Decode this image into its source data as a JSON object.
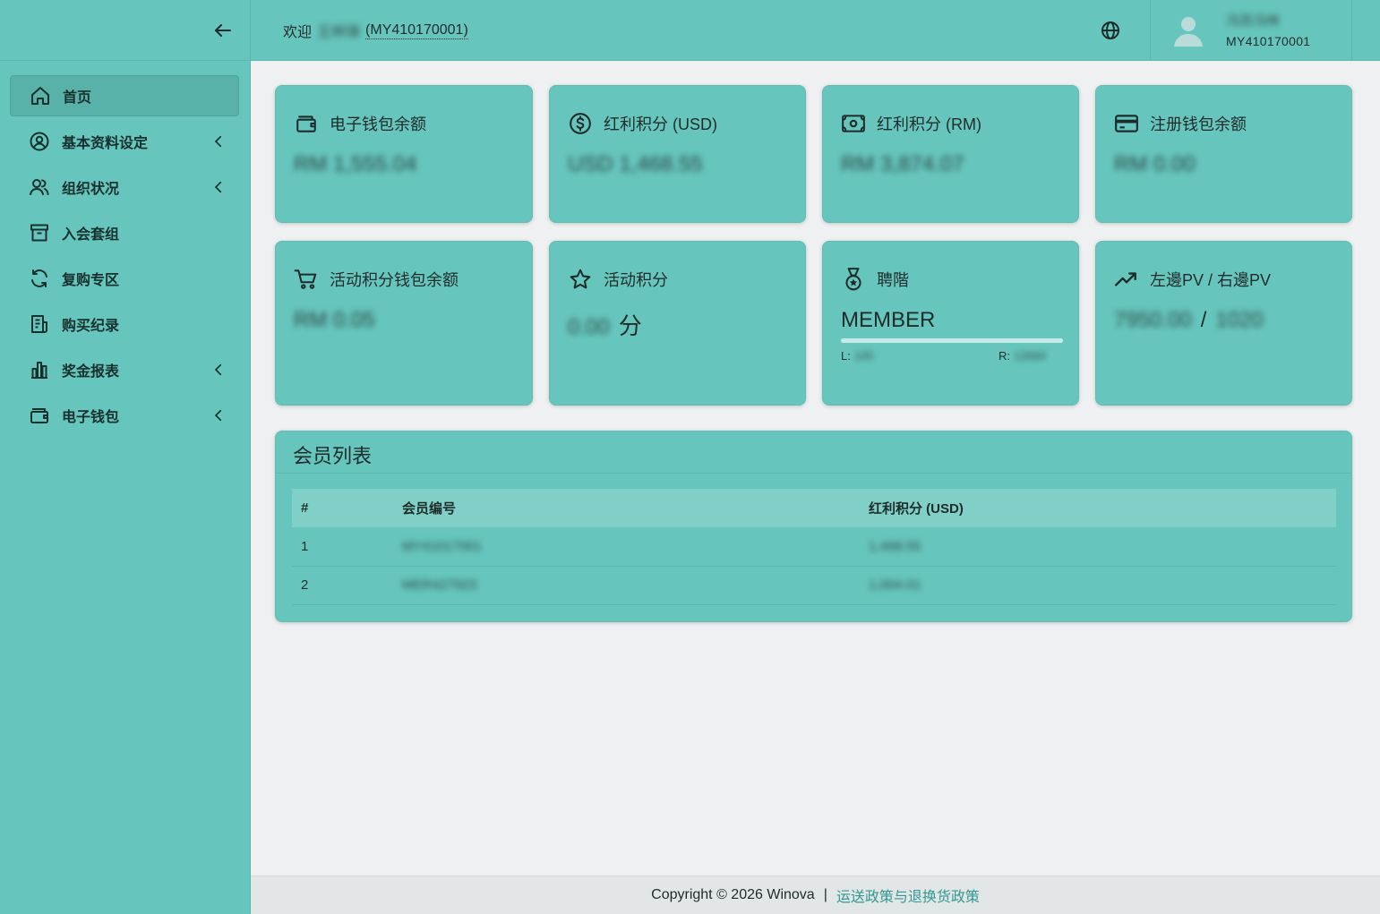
{
  "header": {
    "welcome_label": "欢迎",
    "welcome_name": "王梓琪",
    "welcome_id": "(MY410170001)",
    "user_name": "冯苏冯林",
    "user_id": "MY410170001"
  },
  "sidebar": {
    "items": [
      {
        "label": "首页",
        "icon": "home-icon",
        "active": true
      },
      {
        "label": "基本资料设定",
        "icon": "user-circle-icon",
        "submenu": true
      },
      {
        "label": "组织状况",
        "icon": "users-icon",
        "submenu": true
      },
      {
        "label": "入会套组",
        "icon": "archive-box-icon"
      },
      {
        "label": "复购专区",
        "icon": "refresh-icon"
      },
      {
        "label": "购买纪录",
        "icon": "receipt-icon"
      },
      {
        "label": "奖金报表",
        "icon": "bar-chart-icon",
        "submenu": true
      },
      {
        "label": "电子钱包",
        "icon": "wallet-icon",
        "submenu": true
      }
    ]
  },
  "cards": {
    "ewallet": {
      "title": "电子钱包余额",
      "value": "RM 1,555.04",
      "icon": "wallet-icon"
    },
    "bonus_usd": {
      "title": "红利积分 (USD)",
      "value": "USD 1,468.55",
      "icon": "dollar-circle-icon"
    },
    "bonus_rm": {
      "title": "红利积分 (RM)",
      "value": "RM 3,874.07",
      "icon": "cash-icon"
    },
    "register_wallet": {
      "title": "注册钱包余额",
      "value": "RM 0.00",
      "icon": "credit-card-icon"
    },
    "activity_wallet": {
      "title": "活动积分钱包余额",
      "value": "RM 0.05",
      "icon": "cart-icon"
    },
    "activity_points": {
      "title": "活动积分",
      "value": "0.00",
      "unit": "分",
      "icon": "star-icon"
    },
    "rank": {
      "title": "聘階",
      "value": "MEMBER",
      "progress": 1.0,
      "l_label": "L:",
      "l_value": "105",
      "r_label": "R:",
      "r_value": "12694",
      "icon": "medal-icon"
    },
    "pv": {
      "title": "左邊PV / 右邊PV",
      "left": "7950.00",
      "sep": "/",
      "right": "1020",
      "icon": "trend-up-icon"
    }
  },
  "member_table": {
    "title": "会员列表",
    "columns": [
      "#",
      "会员编号",
      "红利积分 (USD)"
    ],
    "rows": [
      [
        "1",
        "MY41017001",
        "1,468.55"
      ],
      [
        "2",
        "MER427923",
        "1,004.01"
      ]
    ]
  },
  "footer": {
    "copyright": "Copyright © 2026 Winova",
    "sep": "|",
    "policy_link": "运送政策与退换货政策"
  },
  "colors": {
    "accent": "#66c6bd",
    "background": "#eef0f1",
    "link": "#2f9a8f"
  }
}
